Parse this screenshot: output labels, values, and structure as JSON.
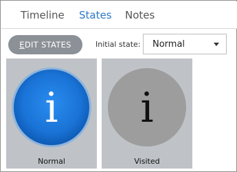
{
  "tabs": [
    {
      "label": "Timeline",
      "active": false
    },
    {
      "label": "States",
      "active": true
    },
    {
      "label": "Notes",
      "active": false
    }
  ],
  "toolbar": {
    "edit_states_mnemonic": "E",
    "edit_states_rest": "DIT STATES",
    "initial_state_label": "Initial state:",
    "initial_state_value": "Normal"
  },
  "states": [
    {
      "label": "Normal",
      "glyph": "i",
      "fill": "#1a73d6",
      "glyph_color": "#ffffff",
      "selected": true
    },
    {
      "label": "Visited",
      "glyph": "i",
      "fill": "#9d9d9d",
      "glyph_color": "#111111",
      "selected": false
    }
  ],
  "colors": {
    "accent": "#2b78c5",
    "card_background": "#bfc3c7",
    "button_background": "#8c9197"
  },
  "icons": {
    "state_glyph": "info-icon",
    "dropdown": "chevron-down-icon"
  }
}
